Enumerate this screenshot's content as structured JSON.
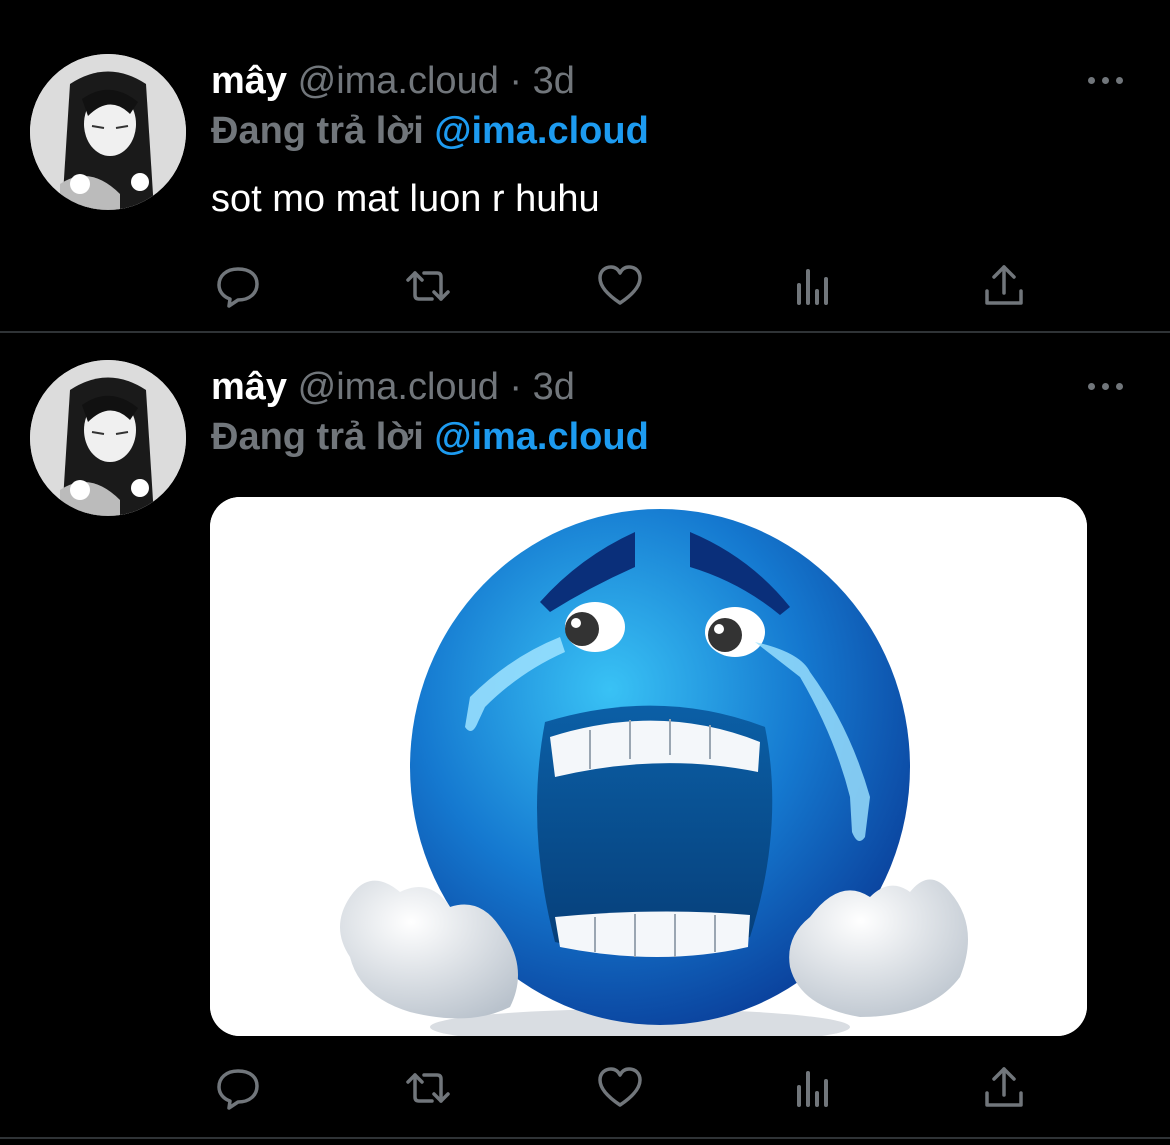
{
  "tweets": [
    {
      "author": {
        "name": "mây",
        "handle": "@ima.cloud",
        "time": "3d",
        "separator": "·"
      },
      "reply": {
        "prefix": "Đang trả lời",
        "mention": "@ima.cloud"
      },
      "text": "sot mo mat luon r huhu",
      "actions": [
        "reply-icon",
        "retweet-icon",
        "like-icon",
        "analytics-icon",
        "share-icon"
      ]
    },
    {
      "author": {
        "name": "mây",
        "handle": "@ima.cloud",
        "time": "3d",
        "separator": "·"
      },
      "reply": {
        "prefix": "Đang trả lời",
        "mention": "@ima.cloud"
      },
      "media": {
        "kind": "image",
        "subject": "crying-blue-emoji"
      },
      "actions": [
        "reply-icon",
        "retweet-icon",
        "like-icon",
        "analytics-icon",
        "share-icon"
      ]
    }
  ],
  "colors": {
    "background": "#000000",
    "secondary_text": "#71767b",
    "accent": "#1d9bf0",
    "divider": "#2f3336"
  }
}
